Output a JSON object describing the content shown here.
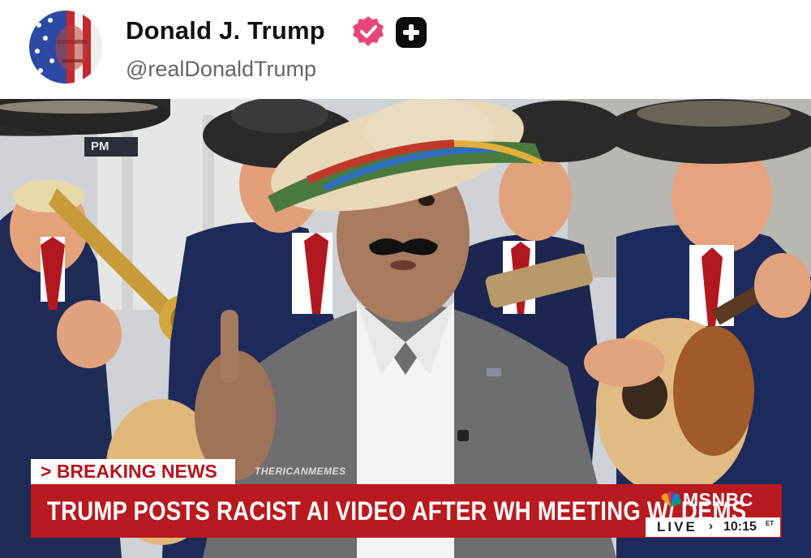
{
  "post": {
    "author": {
      "display_name": "Donald J. Trump",
      "handle": "@realDonaldTrump",
      "avatar_icon": "flag-portrait-avatar",
      "verified_icon": "verified-badge-icon",
      "action_icon": "plus-icon"
    }
  },
  "video": {
    "time_tag": "PM",
    "watermark": "THERICANMEMES",
    "chyron": {
      "label": "> BREAKING NEWS",
      "headline": "TRUMP POSTS RACIST AI VIDEO AFTER WH MEETING W/ DEMS",
      "network": "MSNBC",
      "live": "LIVE",
      "live_arrow": "›",
      "time": "10:15",
      "timezone": "ET"
    }
  },
  "colors": {
    "verified": "#e8457a",
    "chyron_red": "#b81a1f",
    "label_text": "#b3141c"
  }
}
